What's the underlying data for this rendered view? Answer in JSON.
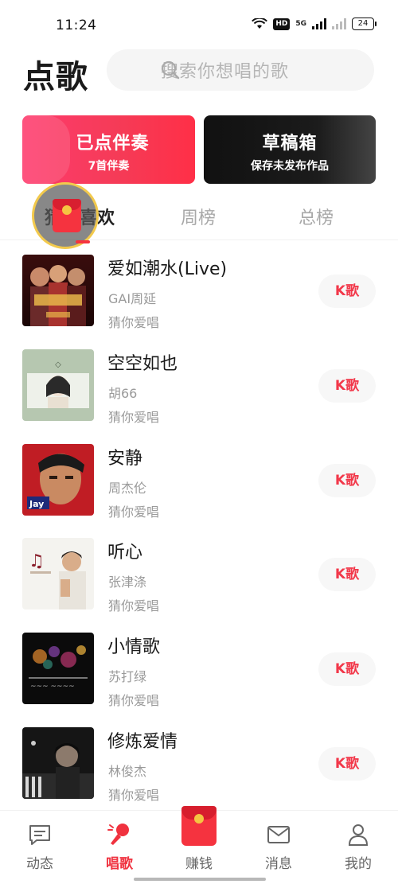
{
  "status_bar": {
    "time": "11:24",
    "network": "5G",
    "hd": "HD",
    "battery": "24"
  },
  "header": {
    "title": "点歌",
    "search_placeholder": "搜索你想唱的歌"
  },
  "cards": {
    "accompaniment": {
      "title": "已点伴奏",
      "subtitle": "7首伴奏"
    },
    "drafts": {
      "title": "草稿箱",
      "subtitle": "保存未发布作品"
    }
  },
  "tabs": [
    {
      "label": "猜你喜欢",
      "active": true
    },
    {
      "label": "周榜",
      "active": false
    },
    {
      "label": "总榜",
      "active": false
    }
  ],
  "songs": [
    {
      "title": "爱如潮水(Live)",
      "artist": "GAI周延",
      "reason": "猜你爱唱",
      "cover_icon": "variety-show-cover",
      "k_label": "K歌"
    },
    {
      "title": "空空如也",
      "artist": "胡66",
      "reason": "猜你爱唱",
      "cover_icon": "green-portrait-cover",
      "k_label": "K歌"
    },
    {
      "title": "安静",
      "artist": "周杰伦",
      "reason": "猜你爱唱",
      "cover_icon": "red-portrait-cover",
      "k_label": "K歌"
    },
    {
      "title": "听心",
      "artist": "张津涤",
      "reason": "猜你爱唱",
      "cover_icon": "white-portrait-cover",
      "k_label": "K歌"
    },
    {
      "title": "小情歌",
      "artist": "苏打绿",
      "reason": "猜你爱唱",
      "cover_icon": "dark-flower-cover",
      "k_label": "K歌"
    },
    {
      "title": "修炼爱情",
      "artist": "林俊杰",
      "reason": "猜你爱唱",
      "cover_icon": "dark-piano-cover",
      "k_label": "K歌"
    }
  ],
  "bottom_nav": [
    {
      "label": "动态",
      "icon": "feed-icon",
      "active": false
    },
    {
      "label": "唱歌",
      "icon": "microphone-icon",
      "active": true
    },
    {
      "label": "赚钱",
      "icon": "red-packet-icon",
      "active": false
    },
    {
      "label": "消息",
      "icon": "mail-icon",
      "active": false
    },
    {
      "label": "我的",
      "icon": "profile-icon",
      "active": false
    }
  ],
  "colors": {
    "accent": "#f0323f",
    "accomp_card": "#f53b57",
    "draft_card": "#151515"
  }
}
